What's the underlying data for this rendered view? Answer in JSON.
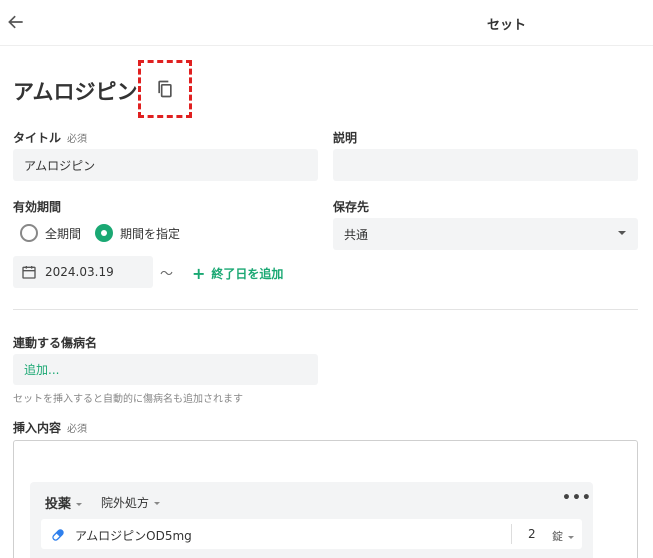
{
  "header": {
    "title": "セット",
    "back_icon": "arrow-left-icon"
  },
  "page": {
    "title": "アムロジピン",
    "copy_icon": "copy-icon"
  },
  "form": {
    "title_label": "タイトル",
    "required_label": "必須",
    "title_value": "アムロジピン",
    "description_label": "説明",
    "description_value": "",
    "period_label": "有効期間",
    "period_options": [
      "全期間",
      "期間を指定"
    ],
    "period_selected": "期間を指定",
    "save_label": "保存先",
    "save_value": "共通",
    "start_date": "2024.03.19",
    "tilde": "〜",
    "add_end_label": "終了日を追加",
    "disease_label": "連動する傷病名",
    "disease_add": "追加...",
    "disease_helper": "セットを挿入すると自動的に傷病名も追加されます",
    "content_label": "挿入内容",
    "content_required": "必須"
  },
  "order": {
    "type": "投薬",
    "sub_type": "院外処方",
    "more": "•••",
    "drug_name": "アムロジピンOD5mg",
    "quantity": "2",
    "unit": "錠"
  },
  "colors": {
    "accent": "#1aa873",
    "highlight": "#e02020",
    "field_bg": "#f3f4f5"
  }
}
